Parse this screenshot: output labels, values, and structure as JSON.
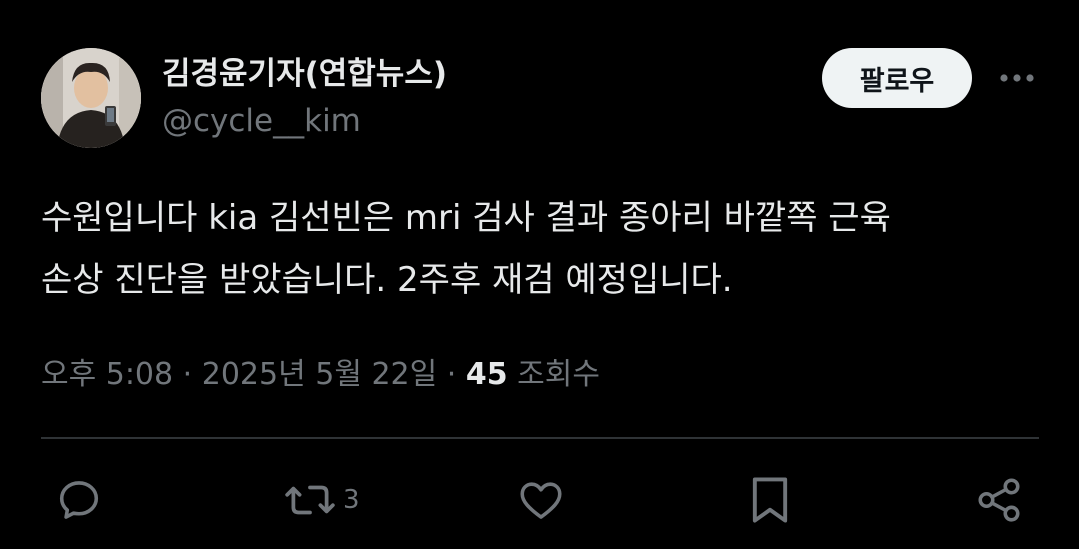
{
  "user": {
    "display_name": "김경윤기자(연합뉴스)",
    "handle": "@cycle__kim",
    "avatar": "profile-photo"
  },
  "follow_label": "팔로우",
  "more_icon": "more-horizontal-icon",
  "tweet": {
    "line1": "수원입니다 kia 김선빈은 mri 검사 결과 종아리 바깥쪽 근육",
    "line2": "손상 진단을 받았습니다. 2주후 재검 예정입니다."
  },
  "meta": {
    "time": "오후 5:08",
    "date": "2025년 5월 22일",
    "separator": "·",
    "views_count": "45",
    "views_label": "조회수"
  },
  "actions": {
    "reply_icon": "reply-icon",
    "retweet_icon": "retweet-icon",
    "retweet_count": "3",
    "like_icon": "heart-icon",
    "bookmark_icon": "bookmark-icon",
    "share_icon": "share-icon"
  },
  "colors": {
    "background": "#000000",
    "text_primary": "#e7e9ea",
    "text_secondary": "#71767b",
    "divider": "#2f3336",
    "follow_bg": "#eff3f4"
  }
}
